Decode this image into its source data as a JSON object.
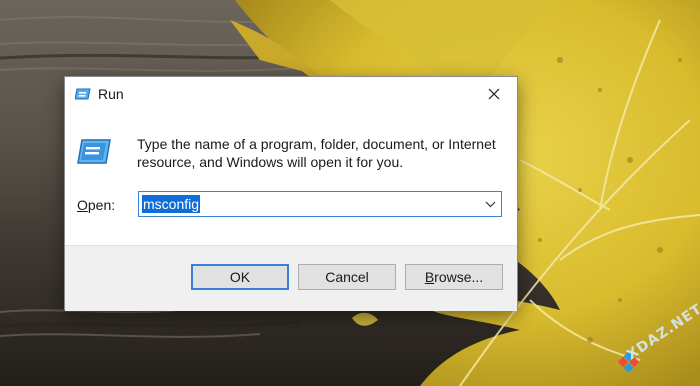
{
  "desktop": {
    "watermark_text": "XDAZ.NET"
  },
  "dialog": {
    "title": "Run",
    "description": "Type the name of a program, folder, document, or Internet resource, and Windows will open it for you.",
    "open_label_accel": "O",
    "open_label_rest": "pen:",
    "open_value": "msconfig",
    "ok_label": "OK",
    "cancel_label": "Cancel",
    "browse_label_accel": "B",
    "browse_label_rest": "rowse...",
    "icons": {
      "title": "run-icon",
      "main": "run-icon",
      "close": "close-icon",
      "dropdown": "chevron-down-icon"
    },
    "colors": {
      "accent": "#3c7fd6",
      "selection": "#0f6dd8",
      "footer": "#f0f0f0"
    }
  }
}
